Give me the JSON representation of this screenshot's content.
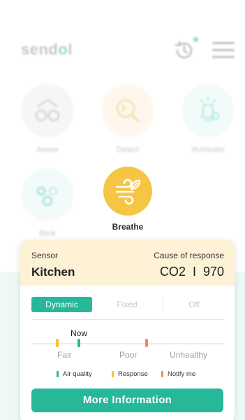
{
  "header": {
    "logo_text_start": "send",
    "logo_text_accent": "o",
    "logo_text_end": "l",
    "icons": {
      "history": "history-icon",
      "menu": "hamburger-menu-icon"
    }
  },
  "modes": [
    {
      "label": "Aware",
      "icon": "glasses-icon"
    },
    {
      "label": "Detect",
      "icon": "magnify-icon"
    },
    {
      "label": "Illuminate",
      "icon": "lightbulb-icon"
    },
    {
      "label": "Blink",
      "icon": "blink-icon"
    },
    {
      "label": "Breathe",
      "icon": "wind-leaf-icon"
    }
  ],
  "card": {
    "sensor_label": "Sensor",
    "sensor_value": "Kitchen",
    "cause_label": "Cause of response",
    "cause_value": "CO2  I  970",
    "tabs": [
      "Dynamic",
      "Fixed",
      "Off"
    ],
    "active_tab": "Dynamic",
    "now_label": "Now",
    "levels": [
      "Fair",
      "Poor",
      "Unhealthy"
    ],
    "legend": [
      "Air quality",
      "Response",
      "Notify me"
    ],
    "button_label": "More Information"
  },
  "colors": {
    "accent_green": "#27b89a",
    "breathe_yellow": "#f6c543",
    "response_yellow": "#f5c13a",
    "notify_orange": "#f0866b",
    "card_header": "#fdf1d6"
  }
}
